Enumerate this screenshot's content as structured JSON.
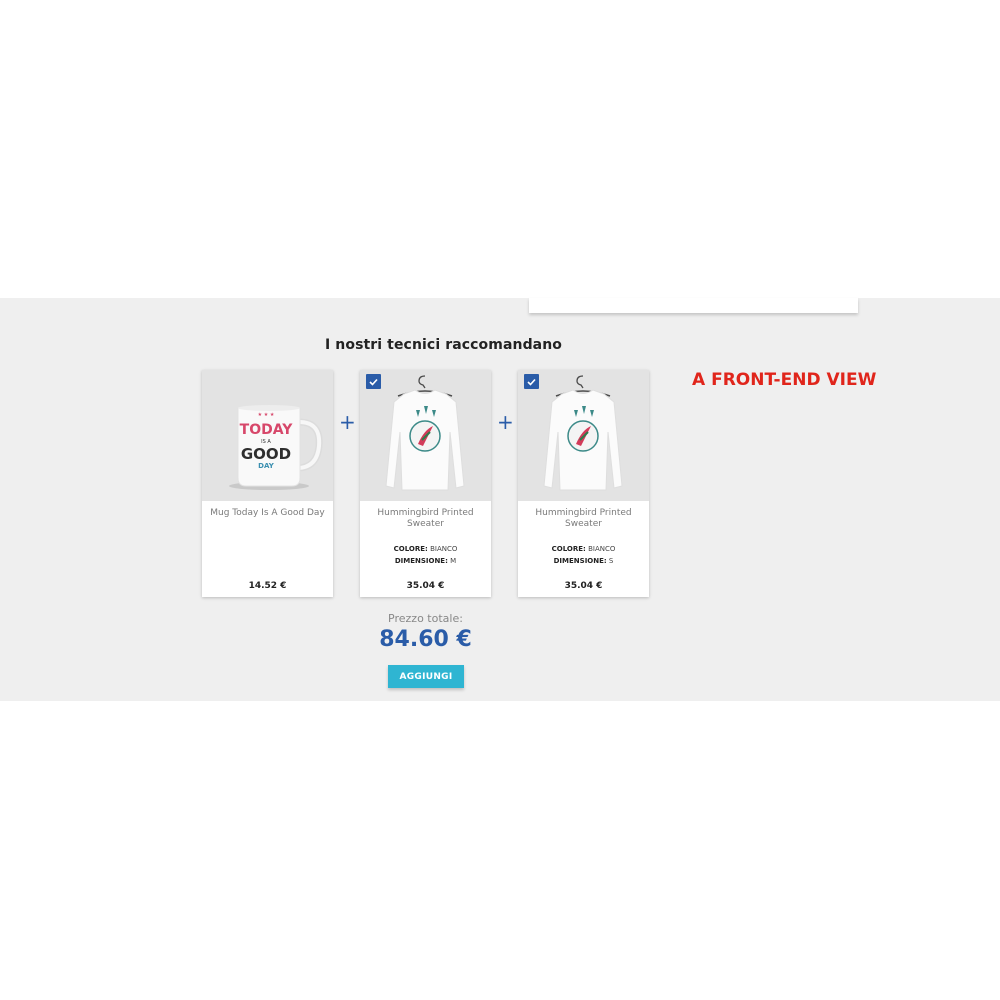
{
  "section": {
    "title": "I nostri tecnici raccomandano",
    "annotation": "A FRONT-END VIEW"
  },
  "products": [
    {
      "name": "Mug Today Is A Good Day",
      "price": "14.52 €",
      "checked": false,
      "image_text": [
        "TODAY",
        "IS A",
        "GOOD",
        "DAY"
      ]
    },
    {
      "name": "Hummingbird Printed Sweater",
      "price": "35.04 €",
      "checked": true,
      "attributes": [
        {
          "label": "COLORE:",
          "value": "BIANCO"
        },
        {
          "label": "DIMENSIONE:",
          "value": "M"
        }
      ]
    },
    {
      "name": "Hummingbird Printed Sweater",
      "price": "35.04 €",
      "checked": true,
      "attributes": [
        {
          "label": "COLORE:",
          "value": "BIANCO"
        },
        {
          "label": "DIMENSIONE:",
          "value": "S"
        }
      ]
    }
  ],
  "separator": "+",
  "total": {
    "label": "Prezzo totale:",
    "value": "84.60 €"
  },
  "add_button_label": "AGGIUNGI",
  "colors": {
    "accent_blue": "#2a5ca8",
    "button": "#2fb5d2",
    "annotation_red": "#e0251b",
    "band_bg": "#efefef"
  }
}
